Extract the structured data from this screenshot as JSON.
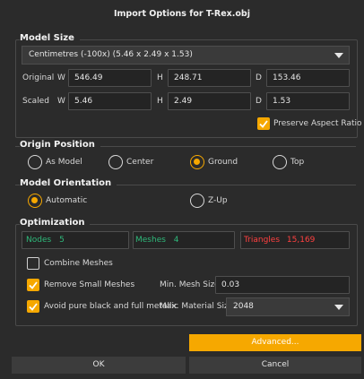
{
  "dialog": {
    "title": "Import Options for T-Rex.obj"
  },
  "model_size": {
    "heading": "Model Size",
    "units_selected": "Centimetres (-100x) (5.46 x 2.49 x 1.53)",
    "original": {
      "label": "Original",
      "w_label": "W",
      "w": "546.49",
      "h_label": "H",
      "h": "248.71",
      "d_label": "D",
      "d": "153.46"
    },
    "scaled": {
      "label": "Scaled",
      "w_label": "W",
      "w": "5.46",
      "h_label": "H",
      "h": "2.49",
      "d_label": "D",
      "d": "1.53"
    },
    "preserve_aspect": {
      "label": "Preserve Aspect Ratio",
      "checked": true
    }
  },
  "origin_position": {
    "heading": "Origin Position",
    "options": [
      {
        "label": "As Model",
        "selected": false
      },
      {
        "label": "Center",
        "selected": false
      },
      {
        "label": "Ground",
        "selected": true
      },
      {
        "label": "Top",
        "selected": false
      }
    ]
  },
  "model_orientation": {
    "heading": "Model Orientation",
    "options": [
      {
        "label": "Automatic",
        "selected": true
      },
      {
        "label": "Z-Up",
        "selected": false
      }
    ]
  },
  "optimization": {
    "heading": "Optimization",
    "nodes_label": "Nodes",
    "nodes": "5",
    "meshes_label": "Meshes",
    "meshes": "4",
    "triangles_label": "Triangles",
    "triangles": "15,169",
    "combine_meshes": {
      "label": "Combine Meshes",
      "checked": false
    },
    "remove_small_meshes": {
      "label": "Remove Small Meshes",
      "checked": true
    },
    "min_mesh_size_label": "Min. Mesh Size",
    "min_mesh_size": "0.03",
    "avoid_black_metallic": {
      "label": "Avoid pure black and full metallic",
      "checked": true
    },
    "max_material_size_label": "Max. Material Size",
    "max_material_size": "2048"
  },
  "buttons": {
    "advanced": "Advanced...",
    "ok": "OK",
    "cancel": "Cancel"
  },
  "colors": {
    "accent": "#f6a800",
    "background": "#2b2b2b",
    "nodes_meshes": "#2fb87a",
    "triangles": "#ff4040"
  }
}
